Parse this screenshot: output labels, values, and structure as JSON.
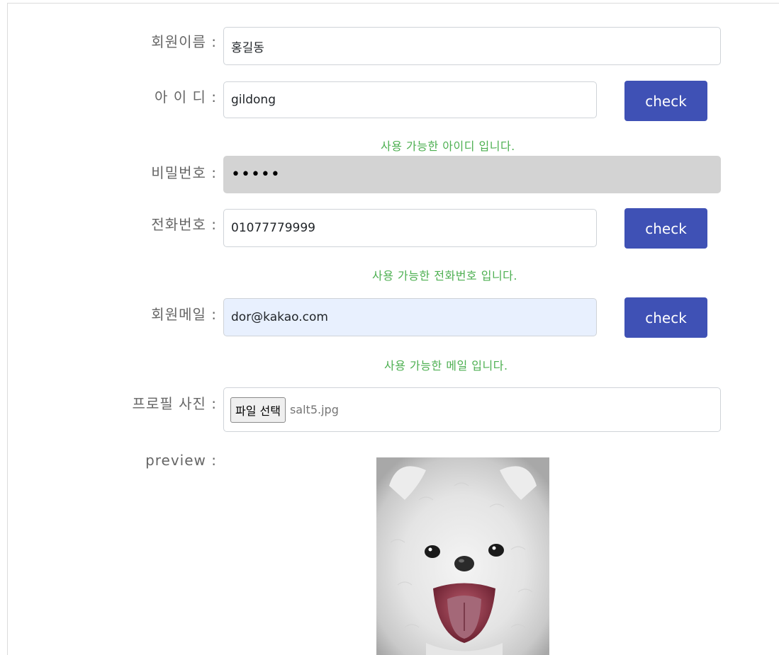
{
  "form": {
    "name": {
      "label": "회원이름 :",
      "value": "홍길동"
    },
    "userid": {
      "label": "아 이 디 :",
      "value": "gildong",
      "button": "check",
      "message": "사용 가능한 아이디 입니다."
    },
    "password": {
      "label": "비밀번호 :",
      "value": "•••••"
    },
    "phone": {
      "label": "전화번호 :",
      "value": "01077779999",
      "button": "check",
      "message": "사용 가능한 전화번호 입니다."
    },
    "email": {
      "label": "회원메일 :",
      "value": "dor@kakao.com",
      "button": "check",
      "message": "사용 가능한 메일 입니다."
    },
    "photo": {
      "label": "프로필 사진 :",
      "file_button": "파일 선택",
      "file_name": "salt5.jpg"
    },
    "preview": {
      "label": "preview :"
    }
  },
  "colors": {
    "button": "#3f51b5",
    "success": "#4caf50",
    "disabled_field": "#d3d3d3",
    "autofill_field": "#e8f0fe"
  }
}
